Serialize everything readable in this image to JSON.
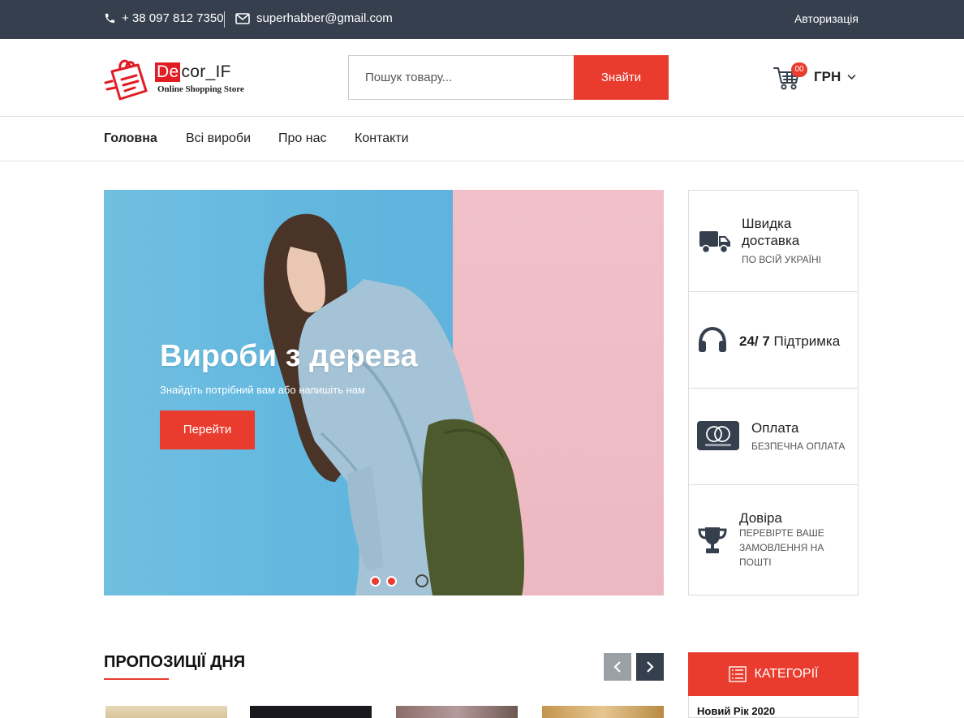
{
  "colors": {
    "topbar": "#363f4d",
    "accent": "#ea3c2e",
    "nav_arrow_inactive": "#9ba0a6",
    "nav_arrow_active": "#363f4d"
  },
  "topbar": {
    "phone": "+ 38 097 812 7350",
    "email": "superhabber@gmail.com",
    "auth": "Авторизація",
    "icons": [
      "phone-icon",
      "envelope-icon"
    ]
  },
  "header": {
    "logo": {
      "brand_de": "De",
      "brand_rest": "cor_IF",
      "tagline": "Online Shopping Store"
    },
    "search": {
      "placeholder": "Пошук товару...",
      "button": "Знайти"
    },
    "cart": {
      "count": "00",
      "icon": "cart-icon"
    },
    "currency": "ГРН"
  },
  "nav": {
    "items": [
      {
        "label": "Головна",
        "active": true
      },
      {
        "label": "Всі вироби",
        "active": false
      },
      {
        "label": "Про нас",
        "active": false
      },
      {
        "label": "Контакти",
        "active": false
      }
    ]
  },
  "slider": {
    "title": "Вироби з дерева",
    "subtitle": "Знайдіть потрібний вам або напишіть нам",
    "button": "Перейти",
    "slides_count": 2,
    "active_slide": 1
  },
  "features": [
    {
      "icon": "truck-icon",
      "title": "Швидка доставка",
      "subtitle": "ПО ВСІЙ УКРАЇНІ"
    },
    {
      "icon": "headphones-icon",
      "title_bold": "24/ 7",
      "title": "Підтримка",
      "subtitle": ""
    },
    {
      "icon": "mastercard-icon",
      "title": "Оплата",
      "subtitle": "БЕЗПЕЧНА ОПЛАТА"
    },
    {
      "icon": "trophy-icon",
      "title": "Довіра",
      "subtitle": "ПЕРЕВІРТЕ ВАШЕ ЗАМОВЛЕННЯ НА ПОШТІ"
    }
  ],
  "offers": {
    "title": "ПРОПОЗИЦІЇ ДНЯ"
  },
  "categories": {
    "button": "КАТЕГОРІЇ",
    "items": [
      "Новий Рік 2020"
    ]
  }
}
